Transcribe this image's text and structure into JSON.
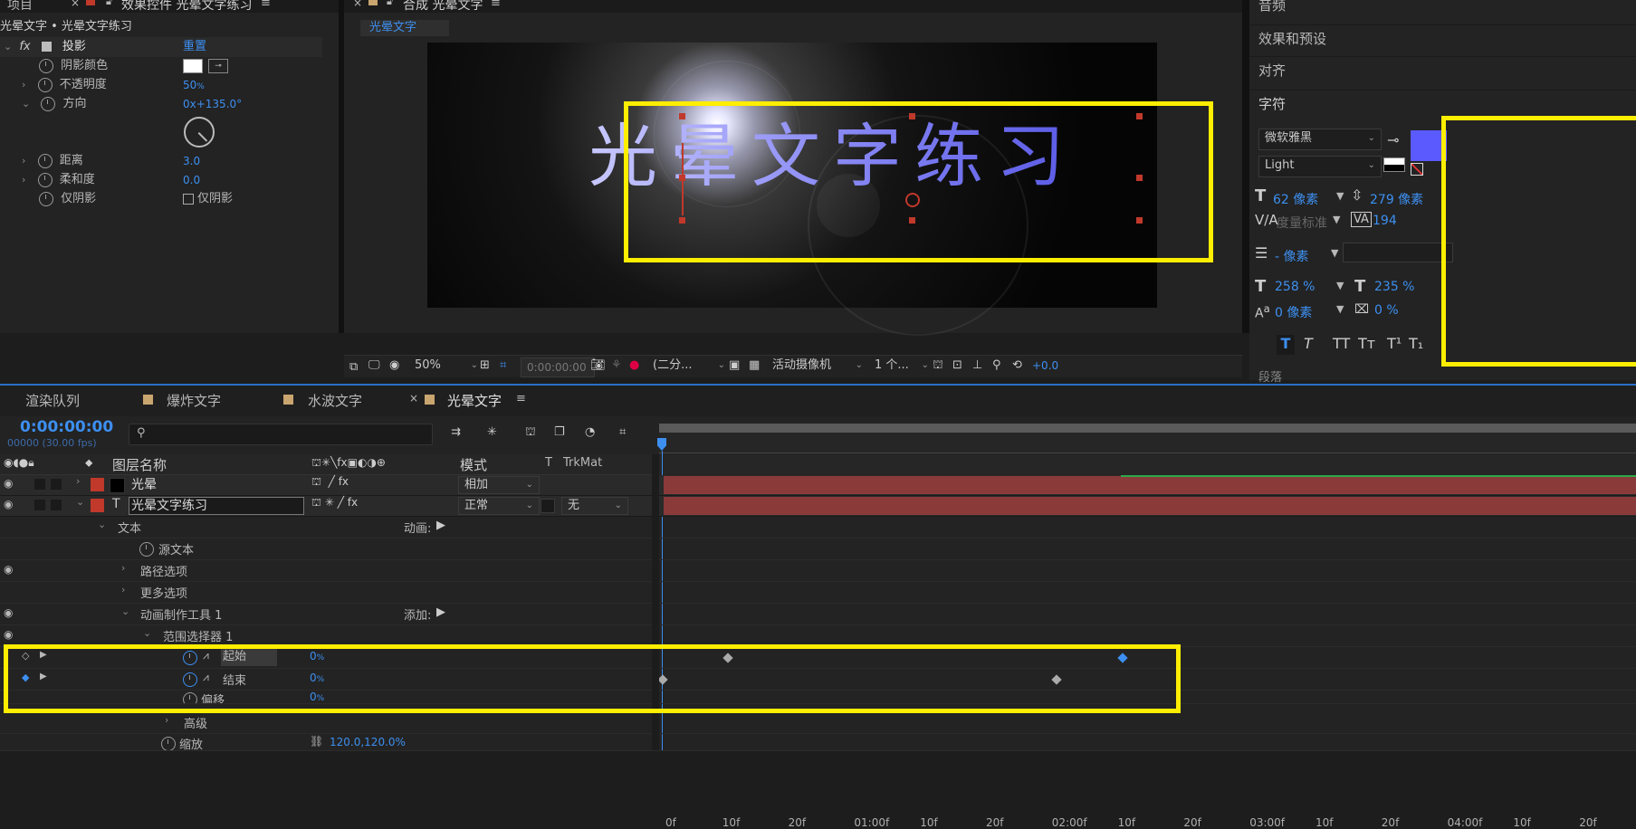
{
  "top_tabs": {
    "project": "项目",
    "effects_panel": "效果控件 光晕文字练习",
    "comp": "合成 光晕文字",
    "audio": "音频"
  },
  "effects_control": {
    "breadcrumb": "光晕文字 • 光晕文字练习",
    "effect_name": "投影",
    "reset": "重置",
    "props": [
      {
        "label": "阴影颜色",
        "value": ""
      },
      {
        "label": "不透明度",
        "value": "50",
        "unit": "%"
      },
      {
        "label": "方向",
        "value": "0x+135.0°"
      },
      {
        "label": "距离",
        "value": "3.0"
      },
      {
        "label": "柔和度",
        "value": "0.0"
      },
      {
        "label": "仅阴影",
        "value": "仅阴影"
      }
    ]
  },
  "comp_viewer": {
    "comp_tab": "光晕文字",
    "title_text": "光晕文字练习",
    "zoom": "50%",
    "timecode": "0:00:00:00",
    "resolution": "(二分...",
    "camera": "活动摄像机",
    "views": "1 个...",
    "exposure": "+0.0"
  },
  "right_panels": {
    "effects_presets": "效果和预设",
    "align": "对齐",
    "character": "字符",
    "font_family": "微软雅黑",
    "font_style": "Light",
    "font_size": "62 像素",
    "leading": "279 像素",
    "kerning": "度量标准",
    "tracking": "194",
    "stroke_width": "- 像素",
    "vert_scale": "258 %",
    "horiz_scale": "235 %",
    "baseline": "0 像素",
    "tsume": "0 %",
    "styles": [
      "T",
      "T",
      "TT",
      "Tт",
      "T¹",
      "T₁"
    ],
    "fill_color": "#5a5aff",
    "next_panel": "段落"
  },
  "timeline": {
    "tabs": [
      "渲染队列",
      "爆炸文字",
      "水波文字",
      "光晕文字"
    ],
    "timecode": "0:00:00:00",
    "fps": "00000 (30.00 fps)",
    "col_name": "图层名称",
    "col_mode": "模式",
    "col_t": "T",
    "col_trkmat": "TrkMat",
    "layers": [
      {
        "name": "光晕",
        "mode": "相加",
        "trkmat": ""
      },
      {
        "name": "光晕文字练习",
        "mode": "正常",
        "trkmat": "无"
      }
    ],
    "tree": {
      "text": "文本",
      "animate": "动画:",
      "source_text": "源文本",
      "path_options": "路径选项",
      "more_options": "更多选项",
      "animator": "动画制作工具 1",
      "add": "添加:",
      "range_selector": "范围选择器 1",
      "start": "起始",
      "start_value": "0",
      "end": "结束",
      "end_value": "0",
      "offset": "偏移",
      "offset_value": "0",
      "advanced": "高级",
      "scale": "缩放",
      "scale_value": "120.0,120.0%"
    },
    "percent": "%",
    "ruler": [
      "0f",
      "10f",
      "20f",
      "01:00f",
      "10f",
      "20f",
      "02:00f",
      "10f",
      "20f",
      "03:00f",
      "10f",
      "20f",
      "04:00f",
      "10f",
      "20f"
    ]
  },
  "colors": {
    "highlight": "#ffee00",
    "accent": "#3d8ff0",
    "layer_bar": "#8b3a3a",
    "title_gradient_start": "#c8c8ff",
    "title_gradient_end": "#5a5ae6"
  }
}
